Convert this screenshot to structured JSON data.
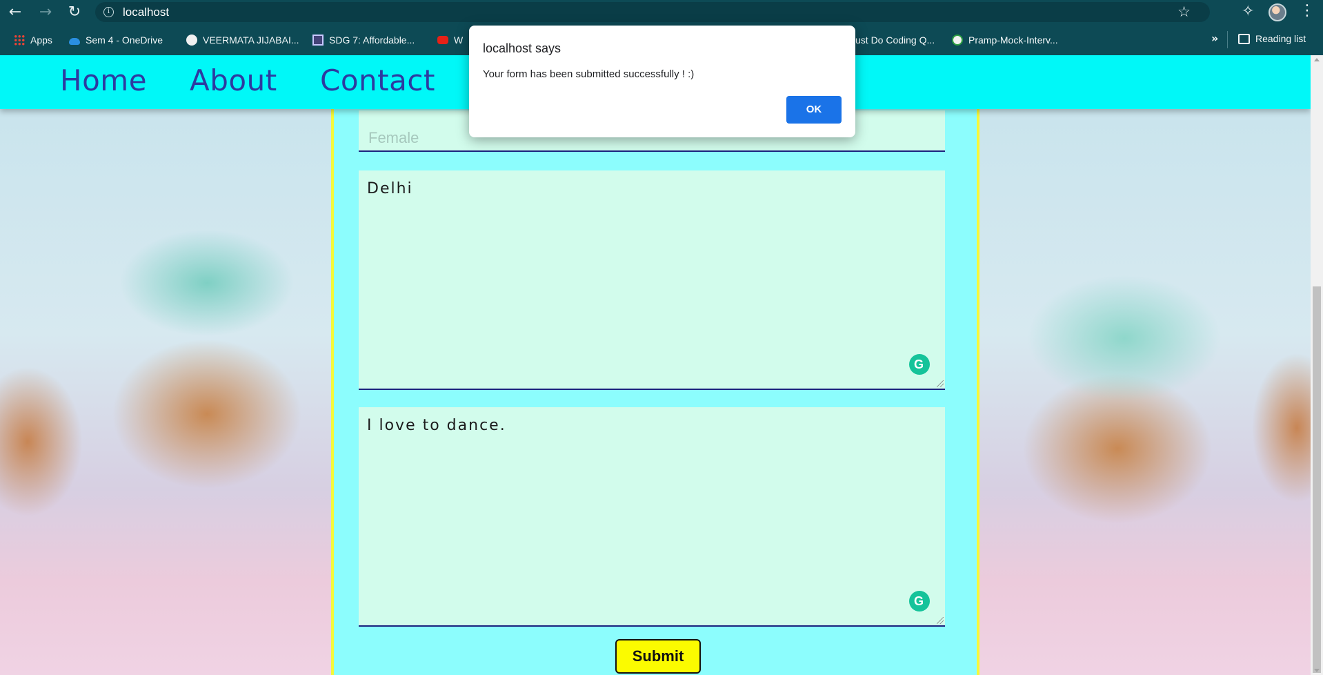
{
  "browser": {
    "url": "localhost",
    "bookmarks": [
      {
        "label": "Apps",
        "icon": "apps-grid-icon"
      },
      {
        "label": "Sem 4 - OneDrive",
        "icon": "onedrive-icon"
      },
      {
        "label": "VEERMATA JIJABAI...",
        "icon": "globe-icon"
      },
      {
        "label": "SDG 7: Affordable...",
        "icon": "un-icon"
      },
      {
        "label": "W",
        "icon": "youtube-icon"
      },
      {
        "label": "ust Do Coding Q...",
        "icon": ""
      },
      {
        "label": "Pramp-Mock-Interv...",
        "icon": "check-icon"
      }
    ],
    "more_bookmarks": "»",
    "reading_list": "Reading list"
  },
  "site_nav": {
    "items": [
      "Home",
      "About",
      "Contact"
    ]
  },
  "form": {
    "faded_field_text": "Female",
    "address_value": "Delhi",
    "message_value": "I love to dance.",
    "submit_label": "Submit"
  },
  "dialog": {
    "title": "localhost says",
    "message": "Your form has been submitted successfully ! :)",
    "ok_label": "OK"
  },
  "colors": {
    "chrome": "#0d4a55",
    "nav": "#00f8f8",
    "form_bg": "#8cfdfd",
    "field_bg": "#d2fcec",
    "submit_bg": "#fbfb00",
    "dialog_ok": "#1a73e8"
  }
}
